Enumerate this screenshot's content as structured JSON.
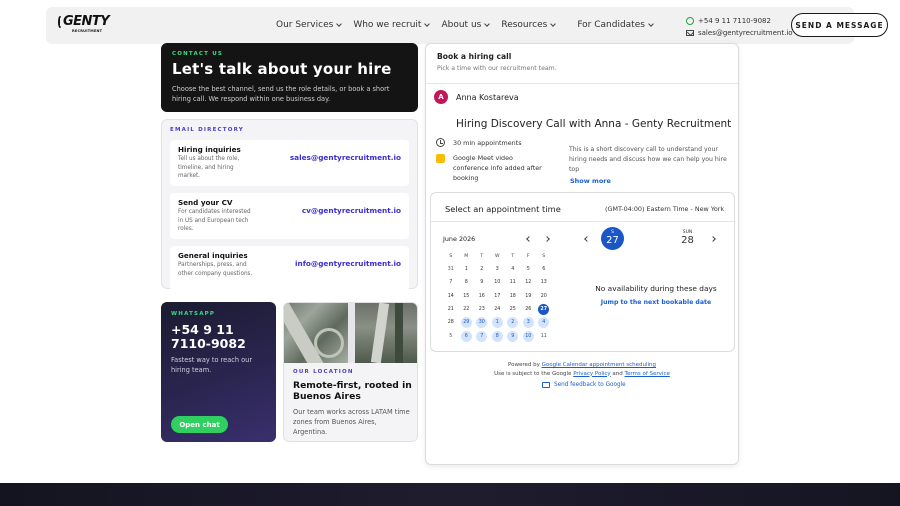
{
  "nav": {
    "logo_word": "GENTY",
    "logo_sub": "RECRUITMENT",
    "menu": [
      {
        "label": "Our Services"
      },
      {
        "label": "Who we recruit"
      },
      {
        "label": "About us"
      },
      {
        "label": "Resources"
      },
      {
        "label": "For Candidates"
      }
    ],
    "phone": "+54 9 11 7110-9082",
    "email": "sales@gentyrecruitment.io",
    "cta": "SEND A MESSAGE"
  },
  "contact_card": {
    "eyebrow": "CONTACT US",
    "title": "Let's talk about your hire",
    "text": "Choose the best channel, send us the role details, or book a short hiring call. We respond within one business day."
  },
  "directory": {
    "eyebrow": "EMAIL DIRECTORY",
    "items": [
      {
        "title": "Hiring inquiries",
        "desc": "Tell us about the role, timeline, and hiring market.",
        "email": "sales@gentyrecruitment.io"
      },
      {
        "title": "Send your CV",
        "desc": "For candidates interested in US and European tech roles.",
        "email": "cv@gentyrecruitment.io"
      },
      {
        "title": "General inquiries",
        "desc": "Partnerships, press, and other company questions.",
        "email": "info@gentyrecruitment.io"
      }
    ]
  },
  "whatsapp": {
    "eyebrow": "WHATSAPP",
    "number_line1": "+54 9 11",
    "number_line2": "7110-9082",
    "text": "Fastest way to reach our hiring team.",
    "button": "Open chat"
  },
  "location": {
    "eyebrow": "OUR LOCATION",
    "title": "Remote-first, rooted in Buenos Aires",
    "text": "Our team works across LATAM time zones from Buenos Aires, Argentina."
  },
  "booking": {
    "header_title": "Book a hiring call",
    "header_sub": "Pick a time with our recruitment team.",
    "host_initial": "A",
    "host_name": "Anna Kostareva",
    "event_title": "Hiring Discovery Call with Anna - Genty Recruitment",
    "duration": "30 min appointments",
    "conference": "Google Meet video conference info added after booking",
    "description": "This is a short discovery call to understand your hiring needs and discuss how we can help you hire top",
    "show_more": "Show more",
    "select_label": "Select an appointment time",
    "timezone": "(GMT-04:00) Eastern Time - New York",
    "month": "June 2026",
    "weekdays": [
      "S",
      "M",
      "T",
      "W",
      "T",
      "F",
      "S"
    ],
    "days": [
      {
        "d": "31",
        "s": "muted"
      },
      {
        "d": "1",
        "s": ""
      },
      {
        "d": "2",
        "s": ""
      },
      {
        "d": "3",
        "s": ""
      },
      {
        "d": "4",
        "s": ""
      },
      {
        "d": "5",
        "s": ""
      },
      {
        "d": "6",
        "s": ""
      },
      {
        "d": "7",
        "s": ""
      },
      {
        "d": "8",
        "s": ""
      },
      {
        "d": "9",
        "s": ""
      },
      {
        "d": "10",
        "s": ""
      },
      {
        "d": "11",
        "s": ""
      },
      {
        "d": "12",
        "s": ""
      },
      {
        "d": "13",
        "s": ""
      },
      {
        "d": "14",
        "s": ""
      },
      {
        "d": "15",
        "s": ""
      },
      {
        "d": "16",
        "s": ""
      },
      {
        "d": "17",
        "s": ""
      },
      {
        "d": "18",
        "s": ""
      },
      {
        "d": "19",
        "s": ""
      },
      {
        "d": "20",
        "s": ""
      },
      {
        "d": "21",
        "s": ""
      },
      {
        "d": "22",
        "s": ""
      },
      {
        "d": "23",
        "s": ""
      },
      {
        "d": "24",
        "s": ""
      },
      {
        "d": "25",
        "s": ""
      },
      {
        "d": "26",
        "s": ""
      },
      {
        "d": "27",
        "s": "sel"
      },
      {
        "d": "28",
        "s": ""
      },
      {
        "d": "29",
        "s": "av"
      },
      {
        "d": "30",
        "s": "av"
      },
      {
        "d": "1",
        "s": "av"
      },
      {
        "d": "2",
        "s": "av"
      },
      {
        "d": "3",
        "s": "av"
      },
      {
        "d": "4",
        "s": "av"
      },
      {
        "d": "5",
        "s": "muted"
      },
      {
        "d": "6",
        "s": "av"
      },
      {
        "d": "7",
        "s": "av"
      },
      {
        "d": "8",
        "s": "av"
      },
      {
        "d": "9",
        "s": "av"
      },
      {
        "d": "10",
        "s": "av"
      },
      {
        "d": "11",
        "s": "muted"
      }
    ],
    "week_day1_label": "S",
    "week_day1_num": "27",
    "week_day2_label": "SUN",
    "week_day2_num": "28",
    "no_availability": "No availability during these days",
    "jump": "Jump to the next bookable date",
    "powered_prefix": "Powered by",
    "powered_link": "Google Calendar appointment scheduling",
    "terms_prefix": "Use is subject to the Google",
    "privacy_link": "Privacy Policy",
    "terms_and": "and",
    "terms_link": "Terms of Service",
    "feedback": "Send feedback to Google"
  },
  "colors": {
    "accent_green": "#3ddc84",
    "accent_purple": "#4a3fbf",
    "google_blue": "#1a56c5"
  }
}
